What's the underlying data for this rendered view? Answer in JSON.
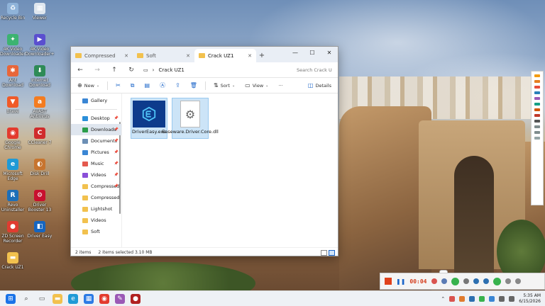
{
  "desktop_icons": [
    {
      "label": "Recycle Bin",
      "name": "recycle-bin-icon",
      "color": "#8fb3d9",
      "glyph": "♻"
    },
    {
      "label": "Viewer",
      "name": "viewer-icon",
      "color": "#dfe7ef",
      "glyph": "▦"
    },
    {
      "label": "4K Video Downloader",
      "name": "4k-video-downloader-icon",
      "color": "#3cb371",
      "glyph": "✦"
    },
    {
      "label": "4K Video Downloader+",
      "name": "4k-downloader-plus-icon",
      "color": "#5a4fcf",
      "glyph": "▶"
    },
    {
      "label": "Ant Download Manager",
      "name": "ant-download-icon",
      "color": "#e8663a",
      "glyph": "✱"
    },
    {
      "label": "Internet Download Manager",
      "name": "idm-icon",
      "color": "#2e8b57",
      "glyph": "⬇"
    },
    {
      "label": "Brave",
      "name": "brave-browser-icon",
      "color": "#f05a28",
      "glyph": "▼"
    },
    {
      "label": "AVAST Antivirus",
      "name": "avast-icon",
      "color": "#f47c20",
      "glyph": "a"
    },
    {
      "label": "Google Chrome",
      "name": "chrome-icon",
      "color": "#e33b2e",
      "glyph": "◉"
    },
    {
      "label": "CCleaner 7",
      "name": "ccleaner-icon",
      "color": "#d02c2c",
      "glyph": "C"
    },
    {
      "label": "Microsoft Edge",
      "name": "edge-icon",
      "color": "#1f9ad6",
      "glyph": "e"
    },
    {
      "label": "Disk Drill",
      "name": "disk-drill-icon",
      "color": "#c7742e",
      "glyph": "◐"
    },
    {
      "label": "Revo Uninstaller",
      "name": "revo-uninstaller-icon",
      "color": "#1e6fb8",
      "glyph": "R"
    },
    {
      "label": "Driver Booster 13",
      "name": "driver-booster-icon",
      "color": "#c8102e",
      "glyph": "⚙"
    },
    {
      "label": "ZD Screen Recorder",
      "name": "zd-recorder-icon",
      "color": "#e03c31",
      "glyph": "●"
    },
    {
      "label": "Driver Easy",
      "name": "driver-easy-icon",
      "color": "#1565c0",
      "glyph": "◧"
    },
    {
      "label": "Crack UZ1",
      "name": "folder-icon",
      "color": "#f2c14e",
      "glyph": "▬"
    }
  ],
  "window": {
    "tabs": [
      {
        "label": "Compressed",
        "active": false
      },
      {
        "label": "Soft",
        "active": false
      },
      {
        "label": "Crack UZ1",
        "active": true
      }
    ],
    "new_tab": "+",
    "controls": {
      "minimize": "—",
      "maximize": "☐",
      "close": "✕"
    },
    "breadcrumb": "Crack UZ1",
    "search_placeholder": "Search Crack U",
    "toolbar": {
      "new_label": "New",
      "sort_label": "Sort",
      "view_label": "View",
      "more_label": "···",
      "details_label": "Details"
    },
    "nav_items": [
      {
        "label": "Gallery",
        "icon": "gallery-icon",
        "color": "#3a86d4",
        "pinned": false,
        "selected": false,
        "divider_after": true
      },
      {
        "label": "Desktop",
        "icon": "desktop-icon",
        "color": "#2b8fd9",
        "pinned": true,
        "selected": false,
        "divider_after": false
      },
      {
        "label": "Downloads",
        "icon": "downloads-icon",
        "color": "#2a9d4a",
        "pinned": true,
        "selected": true,
        "divider_after": false
      },
      {
        "label": "Documents",
        "icon": "documents-icon",
        "color": "#6c8fb5",
        "pinned": true,
        "selected": false,
        "divider_after": false
      },
      {
        "label": "Pictures",
        "icon": "pictures-icon",
        "color": "#3a86d4",
        "pinned": true,
        "selected": false,
        "divider_after": false
      },
      {
        "label": "Music",
        "icon": "music-icon",
        "color": "#e45a4e",
        "pinned": true,
        "selected": false,
        "divider_after": false
      },
      {
        "label": "Videos",
        "icon": "videos-icon",
        "color": "#8a4fd8",
        "pinned": true,
        "selected": false,
        "divider_after": false
      },
      {
        "label": "Compressed",
        "icon": "folder-icon",
        "color": "#f2c14e",
        "pinned": true,
        "selected": false,
        "divider_after": false
      },
      {
        "label": "Compressed",
        "icon": "folder-icon",
        "color": "#f2c14e",
        "pinned": false,
        "selected": false,
        "divider_after": false
      },
      {
        "label": "Lightshot",
        "icon": "folder-icon",
        "color": "#f2c14e",
        "pinned": false,
        "selected": false,
        "divider_after": false
      },
      {
        "label": "Videos",
        "icon": "folder-icon",
        "color": "#f2c14e",
        "pinned": false,
        "selected": false,
        "divider_after": false
      },
      {
        "label": "Soft",
        "icon": "folder-icon",
        "color": "#f2c14e",
        "pinned": false,
        "selected": false,
        "divider_after": false
      }
    ],
    "files": [
      {
        "name": "DriverEasy.exe",
        "type": "exe"
      },
      {
        "name": "Easeware.Driver.Core.dll",
        "type": "dll"
      }
    ],
    "status": {
      "items_count": "2 items",
      "selected": "2 items selected  3.10 MB"
    }
  },
  "recorder": {
    "time": "00:04"
  },
  "taskbar": {
    "icons": [
      {
        "name": "start-icon",
        "color": "#1a73e8",
        "glyph": "⊞"
      },
      {
        "name": "search-icon",
        "color": "#333333",
        "glyph": "⌕"
      },
      {
        "name": "task-view-icon",
        "color": "#555555",
        "glyph": "▭"
      },
      {
        "name": "file-explorer-icon",
        "color": "#f2c14e",
        "glyph": "▬"
      },
      {
        "name": "edge-icon",
        "color": "#1f9ad6",
        "glyph": "e"
      },
      {
        "name": "store-icon",
        "color": "#2c7be5",
        "glyph": "▦"
      },
      {
        "name": "chrome-icon",
        "color": "#e33b2e",
        "glyph": "◉"
      },
      {
        "name": "pen-icon",
        "color": "#9b59b6",
        "glyph": "✎"
      },
      {
        "name": "record-icon",
        "color": "#b02020",
        "glyph": "●"
      }
    ],
    "time": "5:35 AM",
    "date": "6/15/2026"
  }
}
